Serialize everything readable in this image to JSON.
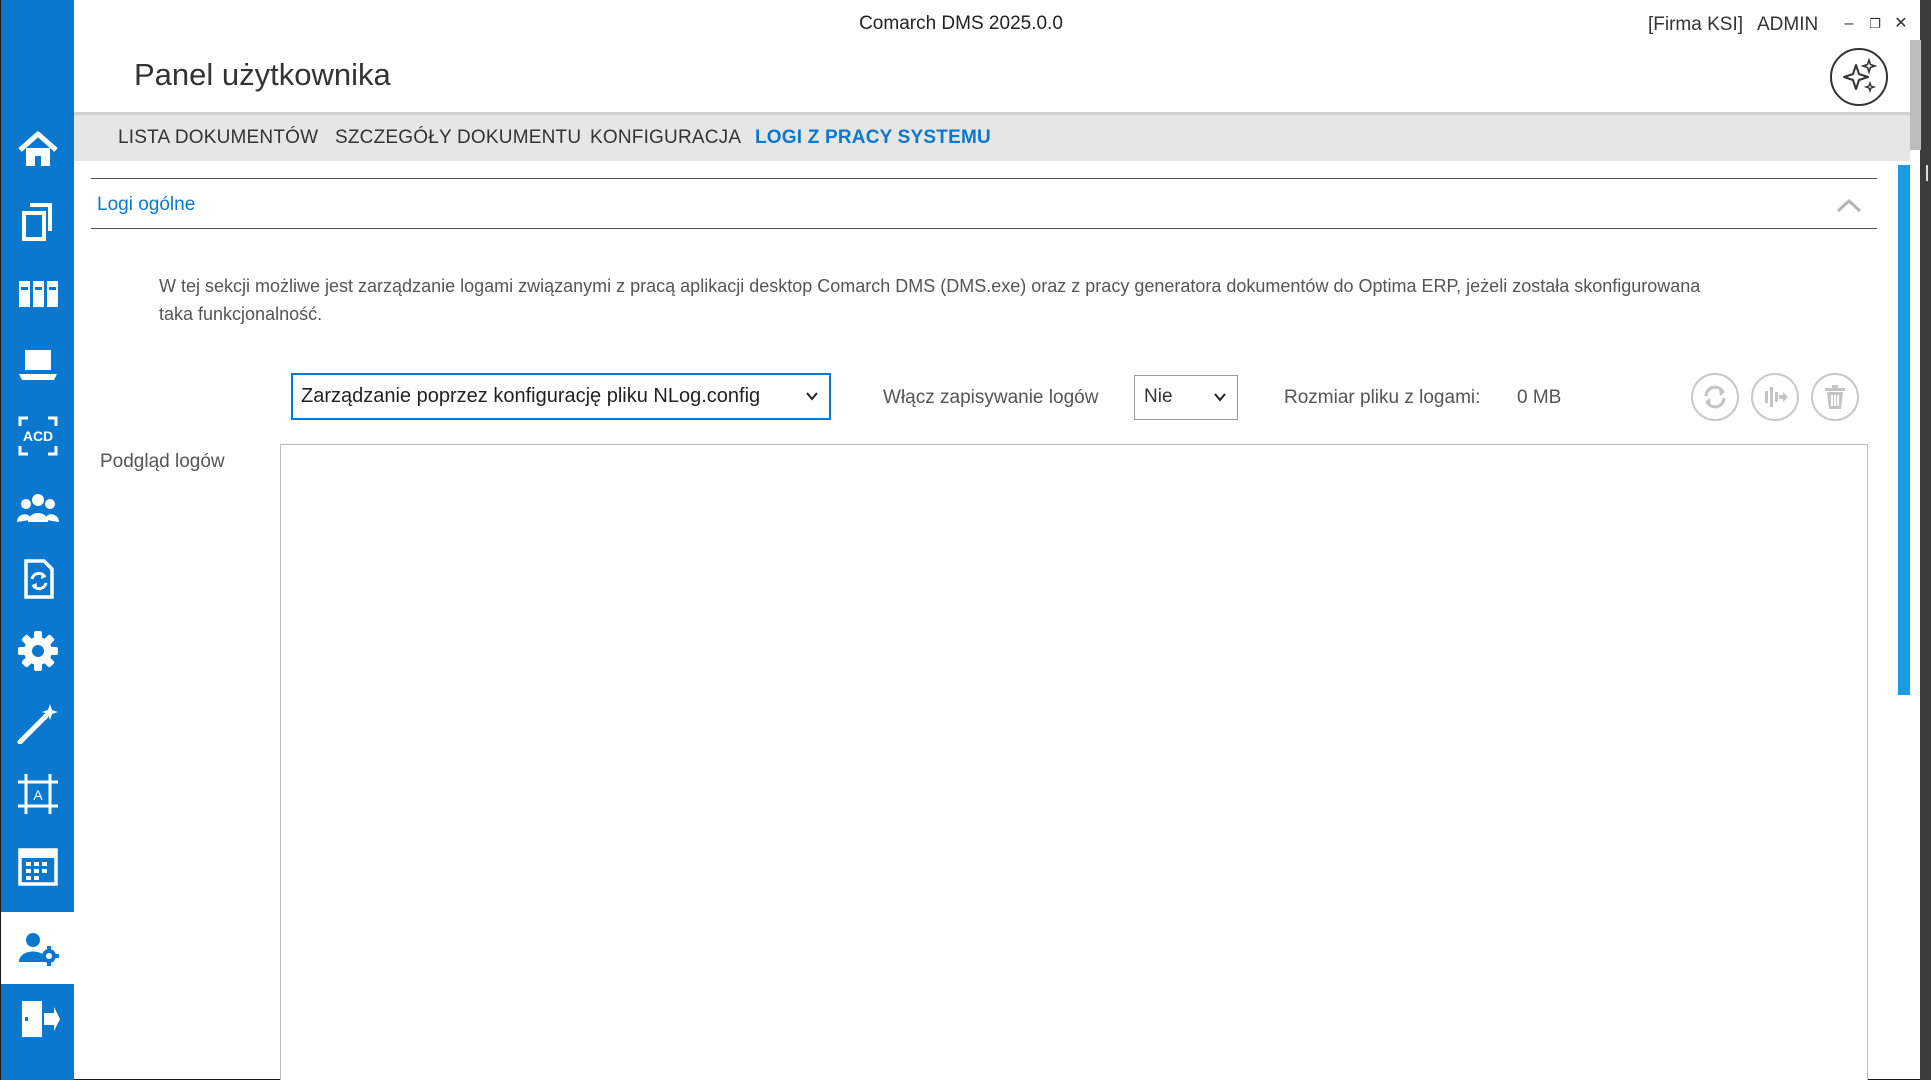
{
  "window": {
    "title": "Comarch DMS 2025.0.0",
    "firm": "[Firma KSI]",
    "user": "ADMIN",
    "minimize": "–",
    "restore": "❐",
    "close": "✕"
  },
  "page": {
    "title": "Panel użytkownika"
  },
  "tabs": [
    {
      "label": "LISTA DOKUMENTÓW"
    },
    {
      "label": "SZCZEGÓŁY DOKUMENTU"
    },
    {
      "label": "KONFIGURACJA"
    },
    {
      "label": "LOGI Z PRACY SYSTEMU",
      "active": true
    }
  ],
  "sidebar": {
    "items": [
      {
        "icon": "home-icon"
      },
      {
        "icon": "documents-icon"
      },
      {
        "icon": "binders-icon"
      },
      {
        "icon": "laptop-icon"
      },
      {
        "icon": "ocr-acd-icon",
        "text": "ACD"
      },
      {
        "icon": "users-icon"
      },
      {
        "icon": "document-sync-icon"
      },
      {
        "icon": "settings-gear-icon"
      },
      {
        "icon": "magic-wand-icon"
      },
      {
        "icon": "template-frame-icon",
        "text": "A"
      },
      {
        "icon": "calendar-icon"
      },
      {
        "icon": "user-settings-icon",
        "active": true
      },
      {
        "icon": "logout-door-icon"
      }
    ],
    "accent": "#0b78d0"
  },
  "section": {
    "title": "Logi ogólne",
    "description": "W tej sekcji możliwe jest zarządzanie logami związanymi z pracą aplikacji desktop Comarch DMS (DMS.exe) oraz z pracy generatora dokumentów do Optima ERP, jeżeli została skonfigurowana taka funkcjonalność."
  },
  "controls": {
    "mode_select": "Zarządzanie poprzez konfigurację pliku NLog.config",
    "enable_label": "Włącz zapisywanie logów",
    "enable_value": "Nie",
    "size_label": "Rozmiar pliku z logami:",
    "size_value": "0 MB",
    "buttons": [
      "refresh-icon",
      "export-logs-icon",
      "delete-trash-icon"
    ]
  },
  "preview": {
    "label": "Podgląd logów",
    "content": ""
  }
}
